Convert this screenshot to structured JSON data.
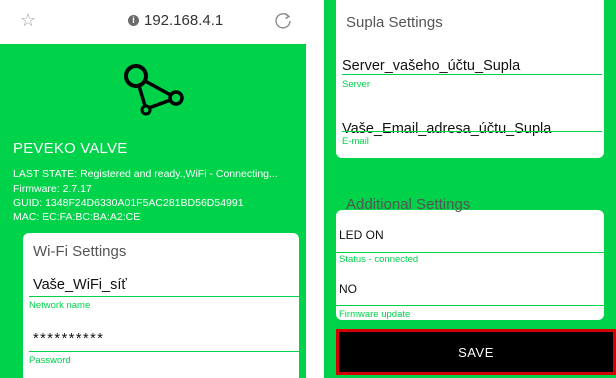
{
  "browser": {
    "url": "192.168.4.1",
    "info_icon": "info-icon",
    "star_icon": "bookmark-star-icon",
    "reload_icon": "reload-icon"
  },
  "device": {
    "logo_icon": "supla-logo-icon",
    "title": "PEVEKO VALVE",
    "last_state": "LAST STATE: Registered and ready.,WiFi - Connecting...",
    "firmware": "Firmware: 2.7.17",
    "guid": "GUID: 1348F24D6330A01F5AC281BD56D54991",
    "mac": "MAC: EC:FA:BC:BA:A2:CE"
  },
  "wifi": {
    "title": "Wi-Fi Settings",
    "network_value": "Vaše_WiFi_síť",
    "network_label": "Network name",
    "password_value": "**********",
    "password_label": "Password"
  },
  "supla": {
    "title": "Supla Settings",
    "server_value": "Server_vašeho_účtu_Supla",
    "server_label": "Server",
    "email_value": "Vaše_Email_adresa_účtu_Supla",
    "email_label": "E-mail"
  },
  "additional": {
    "title": "Additional Settings",
    "led_value": "LED ON",
    "led_label": "Status - connected",
    "fw_value": "NO",
    "fw_label": "Firmware update"
  },
  "save_label": "SAVE",
  "colors": {
    "accent": "#00d34a",
    "save_border": "#d40000",
    "save_bg": "#000000"
  }
}
